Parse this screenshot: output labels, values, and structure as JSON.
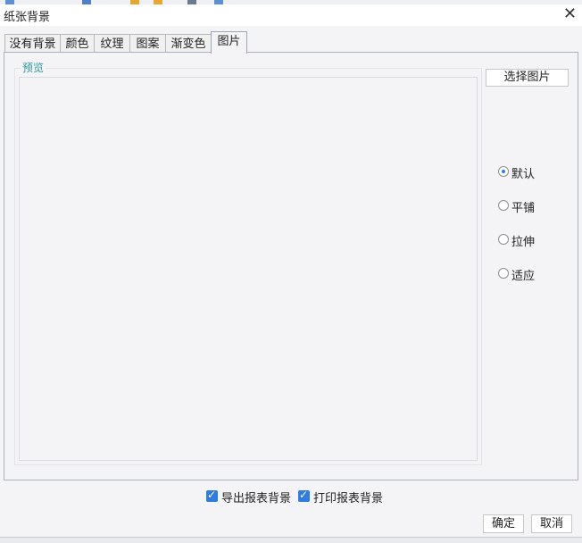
{
  "window": {
    "title": "纸张背景",
    "close_glyph": "✕"
  },
  "tabs": [
    {
      "label": "没有背景",
      "active": false
    },
    {
      "label": "颜色",
      "active": false
    },
    {
      "label": "纹理",
      "active": false
    },
    {
      "label": "图案",
      "active": false
    },
    {
      "label": "渐变色",
      "active": false
    },
    {
      "label": "图片",
      "active": true
    }
  ],
  "preview": {
    "label": "预览"
  },
  "select_image_button": "选择图片",
  "layout_options": [
    {
      "label": "默认",
      "selected": true
    },
    {
      "label": "平铺",
      "selected": false
    },
    {
      "label": "拉伸",
      "selected": false
    },
    {
      "label": "适应",
      "selected": false
    }
  ],
  "checkboxes": [
    {
      "label": "导出报表背景",
      "checked": true
    },
    {
      "label": "打印报表背景",
      "checked": true
    }
  ],
  "buttons": {
    "ok": "确定",
    "cancel": "取消"
  },
  "colors": {
    "accent": "#2f7de0",
    "preview_label": "#2a9aa0",
    "panel_bg": "#f4f4f7"
  }
}
